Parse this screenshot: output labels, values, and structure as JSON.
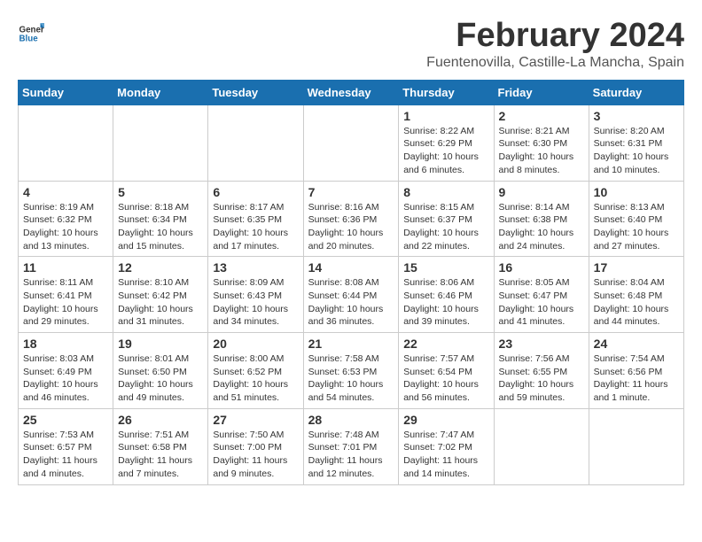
{
  "logo": {
    "general": "General",
    "blue": "Blue"
  },
  "title": "February 2024",
  "location": "Fuentenovilla, Castille-La Mancha, Spain",
  "days_of_week": [
    "Sunday",
    "Monday",
    "Tuesday",
    "Wednesday",
    "Thursday",
    "Friday",
    "Saturday"
  ],
  "weeks": [
    [
      {
        "day": "",
        "info": ""
      },
      {
        "day": "",
        "info": ""
      },
      {
        "day": "",
        "info": ""
      },
      {
        "day": "",
        "info": ""
      },
      {
        "day": "1",
        "info": "Sunrise: 8:22 AM\nSunset: 6:29 PM\nDaylight: 10 hours\nand 6 minutes."
      },
      {
        "day": "2",
        "info": "Sunrise: 8:21 AM\nSunset: 6:30 PM\nDaylight: 10 hours\nand 8 minutes."
      },
      {
        "day": "3",
        "info": "Sunrise: 8:20 AM\nSunset: 6:31 PM\nDaylight: 10 hours\nand 10 minutes."
      }
    ],
    [
      {
        "day": "4",
        "info": "Sunrise: 8:19 AM\nSunset: 6:32 PM\nDaylight: 10 hours\nand 13 minutes."
      },
      {
        "day": "5",
        "info": "Sunrise: 8:18 AM\nSunset: 6:34 PM\nDaylight: 10 hours\nand 15 minutes."
      },
      {
        "day": "6",
        "info": "Sunrise: 8:17 AM\nSunset: 6:35 PM\nDaylight: 10 hours\nand 17 minutes."
      },
      {
        "day": "7",
        "info": "Sunrise: 8:16 AM\nSunset: 6:36 PM\nDaylight: 10 hours\nand 20 minutes."
      },
      {
        "day": "8",
        "info": "Sunrise: 8:15 AM\nSunset: 6:37 PM\nDaylight: 10 hours\nand 22 minutes."
      },
      {
        "day": "9",
        "info": "Sunrise: 8:14 AM\nSunset: 6:38 PM\nDaylight: 10 hours\nand 24 minutes."
      },
      {
        "day": "10",
        "info": "Sunrise: 8:13 AM\nSunset: 6:40 PM\nDaylight: 10 hours\nand 27 minutes."
      }
    ],
    [
      {
        "day": "11",
        "info": "Sunrise: 8:11 AM\nSunset: 6:41 PM\nDaylight: 10 hours\nand 29 minutes."
      },
      {
        "day": "12",
        "info": "Sunrise: 8:10 AM\nSunset: 6:42 PM\nDaylight: 10 hours\nand 31 minutes."
      },
      {
        "day": "13",
        "info": "Sunrise: 8:09 AM\nSunset: 6:43 PM\nDaylight: 10 hours\nand 34 minutes."
      },
      {
        "day": "14",
        "info": "Sunrise: 8:08 AM\nSunset: 6:44 PM\nDaylight: 10 hours\nand 36 minutes."
      },
      {
        "day": "15",
        "info": "Sunrise: 8:06 AM\nSunset: 6:46 PM\nDaylight: 10 hours\nand 39 minutes."
      },
      {
        "day": "16",
        "info": "Sunrise: 8:05 AM\nSunset: 6:47 PM\nDaylight: 10 hours\nand 41 minutes."
      },
      {
        "day": "17",
        "info": "Sunrise: 8:04 AM\nSunset: 6:48 PM\nDaylight: 10 hours\nand 44 minutes."
      }
    ],
    [
      {
        "day": "18",
        "info": "Sunrise: 8:03 AM\nSunset: 6:49 PM\nDaylight: 10 hours\nand 46 minutes."
      },
      {
        "day": "19",
        "info": "Sunrise: 8:01 AM\nSunset: 6:50 PM\nDaylight: 10 hours\nand 49 minutes."
      },
      {
        "day": "20",
        "info": "Sunrise: 8:00 AM\nSunset: 6:52 PM\nDaylight: 10 hours\nand 51 minutes."
      },
      {
        "day": "21",
        "info": "Sunrise: 7:58 AM\nSunset: 6:53 PM\nDaylight: 10 hours\nand 54 minutes."
      },
      {
        "day": "22",
        "info": "Sunrise: 7:57 AM\nSunset: 6:54 PM\nDaylight: 10 hours\nand 56 minutes."
      },
      {
        "day": "23",
        "info": "Sunrise: 7:56 AM\nSunset: 6:55 PM\nDaylight: 10 hours\nand 59 minutes."
      },
      {
        "day": "24",
        "info": "Sunrise: 7:54 AM\nSunset: 6:56 PM\nDaylight: 11 hours\nand 1 minute."
      }
    ],
    [
      {
        "day": "25",
        "info": "Sunrise: 7:53 AM\nSunset: 6:57 PM\nDaylight: 11 hours\nand 4 minutes."
      },
      {
        "day": "26",
        "info": "Sunrise: 7:51 AM\nSunset: 6:58 PM\nDaylight: 11 hours\nand 7 minutes."
      },
      {
        "day": "27",
        "info": "Sunrise: 7:50 AM\nSunset: 7:00 PM\nDaylight: 11 hours\nand 9 minutes."
      },
      {
        "day": "28",
        "info": "Sunrise: 7:48 AM\nSunset: 7:01 PM\nDaylight: 11 hours\nand 12 minutes."
      },
      {
        "day": "29",
        "info": "Sunrise: 7:47 AM\nSunset: 7:02 PM\nDaylight: 11 hours\nand 14 minutes."
      },
      {
        "day": "",
        "info": ""
      },
      {
        "day": "",
        "info": ""
      }
    ]
  ]
}
